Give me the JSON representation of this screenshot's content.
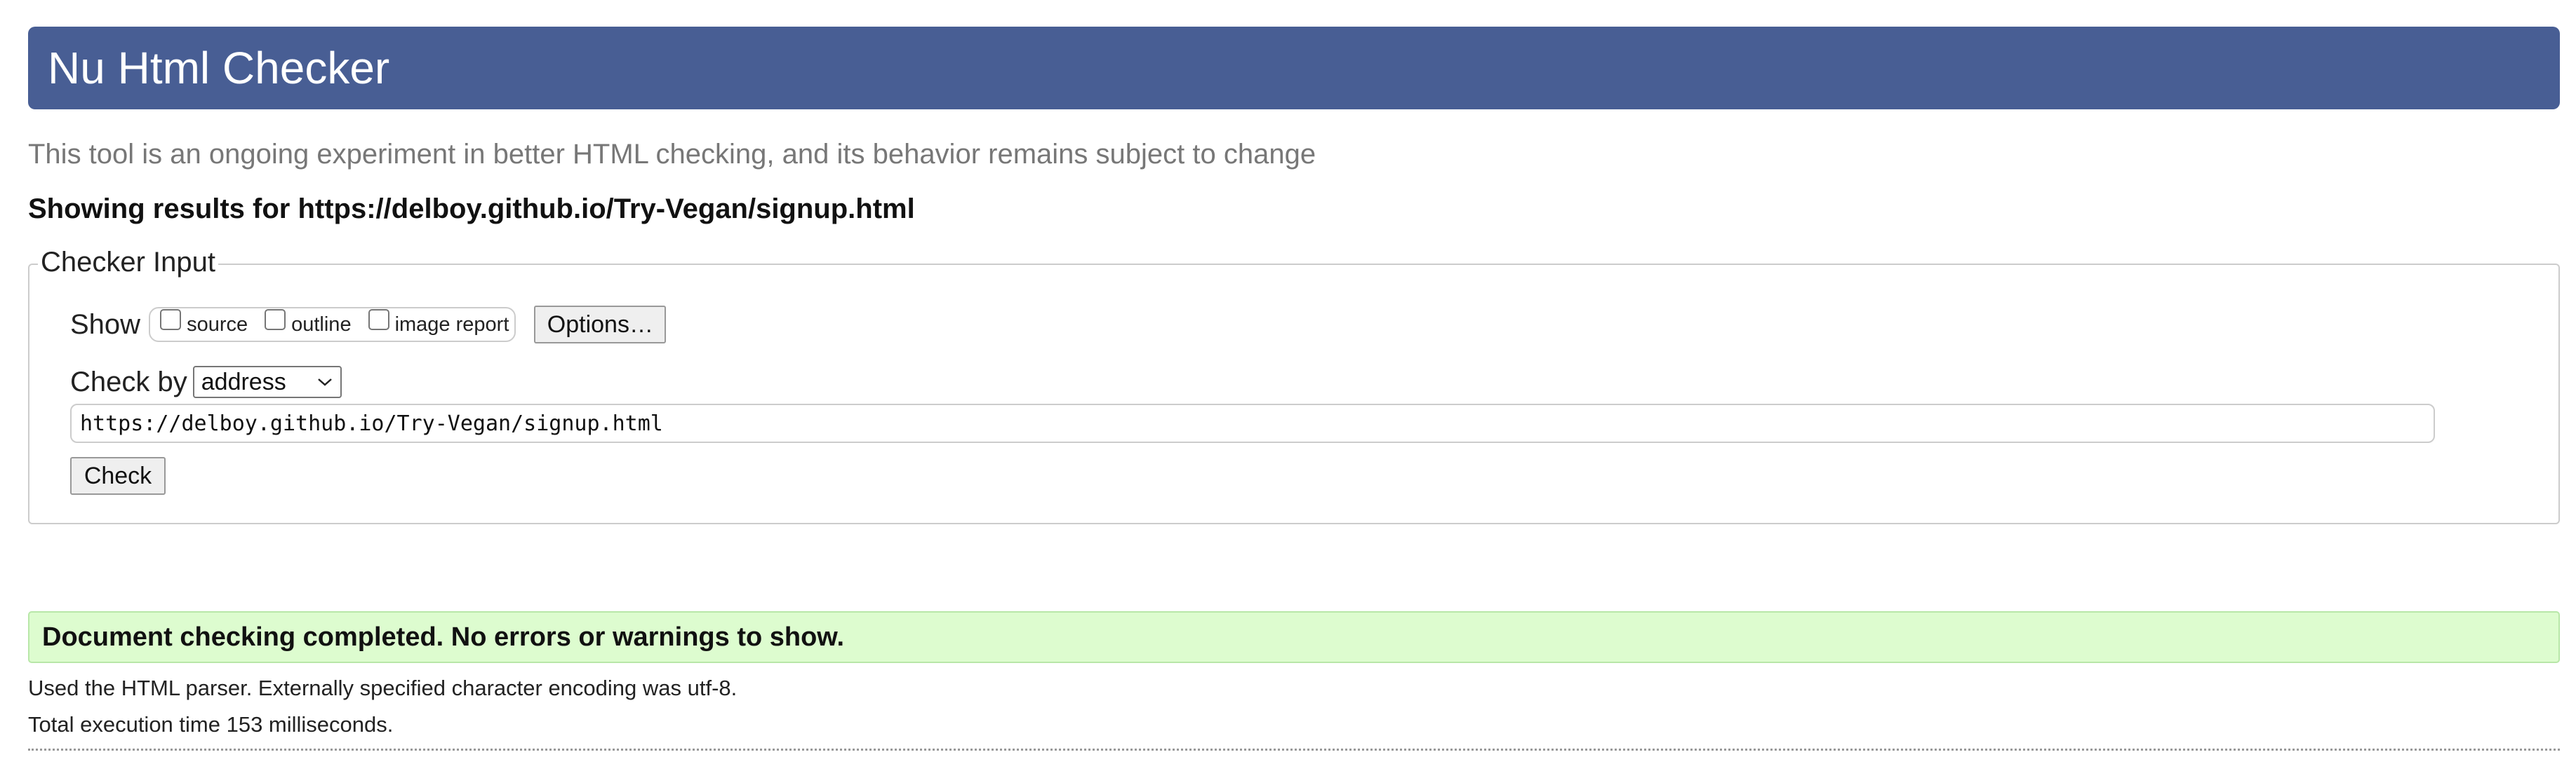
{
  "header": {
    "title": "Nu Html Checker"
  },
  "tagline": "This tool is an ongoing experiment in better HTML checking, and its behavior remains subject to change",
  "results_heading": "Showing results for https://delboy.github.io/Try-Vegan/signup.html",
  "checker_input": {
    "legend": "Checker Input",
    "show_label": "Show",
    "checkboxes": [
      {
        "label": "source",
        "checked": false
      },
      {
        "label": "outline",
        "checked": false
      },
      {
        "label": "image report",
        "checked": false
      }
    ],
    "options_button": "Options…",
    "check_by_label": "Check by",
    "check_by_value": "address",
    "url_value": "https://delboy.github.io/Try-Vegan/signup.html",
    "check_button": "Check"
  },
  "status": {
    "message": "Document checking completed. No errors or warnings to show.",
    "parser_info": "Used the HTML parser. Externally specified character encoding was utf-8.",
    "execution_time": "Total execution time 153 milliseconds."
  },
  "colors": {
    "banner": "#485e94",
    "success_bg": "#ddfccf",
    "success_border": "#b8e7a8"
  },
  "icons": {
    "select_arrow": "chevron-down-icon"
  }
}
